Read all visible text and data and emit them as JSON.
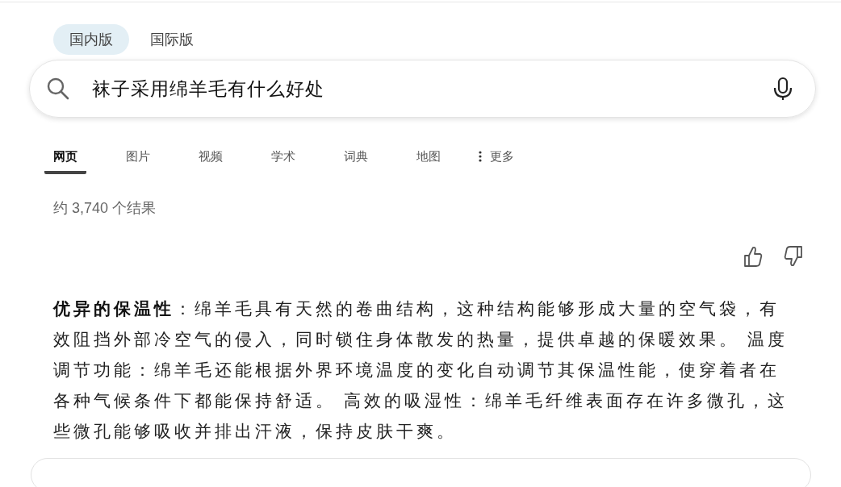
{
  "versions": [
    {
      "label": "国内版",
      "selected": true
    },
    {
      "label": "国际版",
      "selected": false
    }
  ],
  "search": {
    "value": "袜子采用绵羊毛有什么好处"
  },
  "tabs": [
    {
      "label": "网页",
      "selected": true,
      "kind": "plain"
    },
    {
      "label": "图片",
      "selected": false,
      "kind": "plain"
    },
    {
      "label": "视频",
      "selected": false,
      "kind": "plain"
    },
    {
      "label": "学术",
      "selected": false,
      "kind": "plain"
    },
    {
      "label": "词典",
      "selected": false,
      "kind": "plain"
    },
    {
      "label": "地图",
      "selected": false,
      "kind": "plain"
    },
    {
      "label": "更多",
      "selected": false,
      "kind": "more"
    }
  ],
  "result_count": "约 3,740 个结果",
  "answer": "**优异的保温性**：绵羊毛具有天然的卷曲结构，这种结构能够形成大量的空气袋，有效阻挡外部冷空气的侵入，同时锁住身体散发的热量，提供卓越的保暖效果。 温度调节功能：绵羊毛还能根据外界环境温度的变化自动调节其保温性能，使穿着者在各种气候条件下都能保持舒适。 高效的吸湿性：绵羊毛纤维表面存在许多微孔，这些微孔能够吸收并排出汗液，保持皮肤干爽。"
}
